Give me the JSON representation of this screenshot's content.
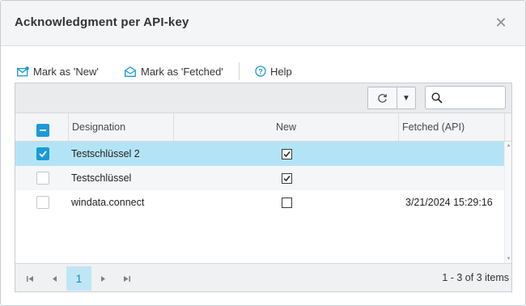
{
  "dialog": {
    "title": "Acknowledgment per API-key",
    "close_glyph": "✕"
  },
  "toolbar": {
    "mark_new_label": "Mark as 'New'",
    "mark_fetched_label": "Mark as 'Fetched'",
    "help_label": "Help"
  },
  "grid": {
    "search_placeholder": "",
    "columns": {
      "designation": "Designation",
      "new": "New",
      "fetched": "Fetched (API)"
    },
    "rows": [
      {
        "designation": "Testschlüssel 2",
        "new": true,
        "fetched": "",
        "selected": true
      },
      {
        "designation": "Testschlüssel",
        "new": true,
        "fetched": "",
        "selected": false
      },
      {
        "designation": "windata.connect",
        "new": false,
        "fetched": "3/21/2024 15:29:16",
        "selected": false
      }
    ]
  },
  "pager": {
    "current_page": "1",
    "info": "1 - 3 of 3 items"
  },
  "colors": {
    "accent": "#1a9ad6",
    "selected_row": "#b3e4f5"
  }
}
